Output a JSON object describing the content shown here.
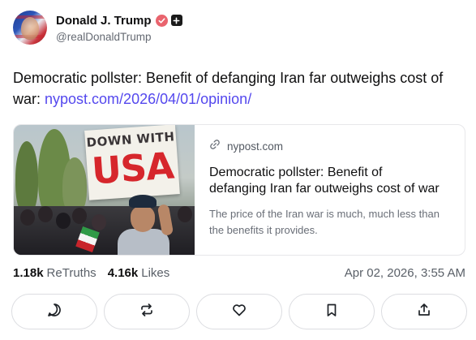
{
  "post": {
    "author_name": "Donald J. Trump",
    "author_handle": "@realDonaldTrump",
    "text": "Democratic pollster: Benefit of defanging Iran far outweighs cost of war: ",
    "link_text": "nypost.com/2026/04/01/opinion/"
  },
  "card": {
    "domain": "nypost.com",
    "title": "Democratic pollster: Benefit of defanging Iran far outweighs cost of war",
    "description": "The price of the Iran war is much, much less than the benefits it provides.",
    "image_sign_top": "DOWN WITH",
    "image_sign_main": "USA"
  },
  "stats": {
    "retruths_count": "1.18k",
    "retruths_label": "ReTruths",
    "likes_count": "4.16k",
    "likes_label": "Likes",
    "timestamp": "Apr 02, 2026, 3:55 AM"
  },
  "icons": {
    "verified": "verified-badge-icon",
    "plus": "plus-badge-icon",
    "link": "link-icon",
    "reply": "reply-icon",
    "retruth": "retruth-icon",
    "like": "heart-icon",
    "save": "bookmark-icon",
    "share": "share-icon"
  },
  "colors": {
    "link": "#5448ee",
    "verified_badge": "#e9646e",
    "border": "#dcdde1"
  }
}
